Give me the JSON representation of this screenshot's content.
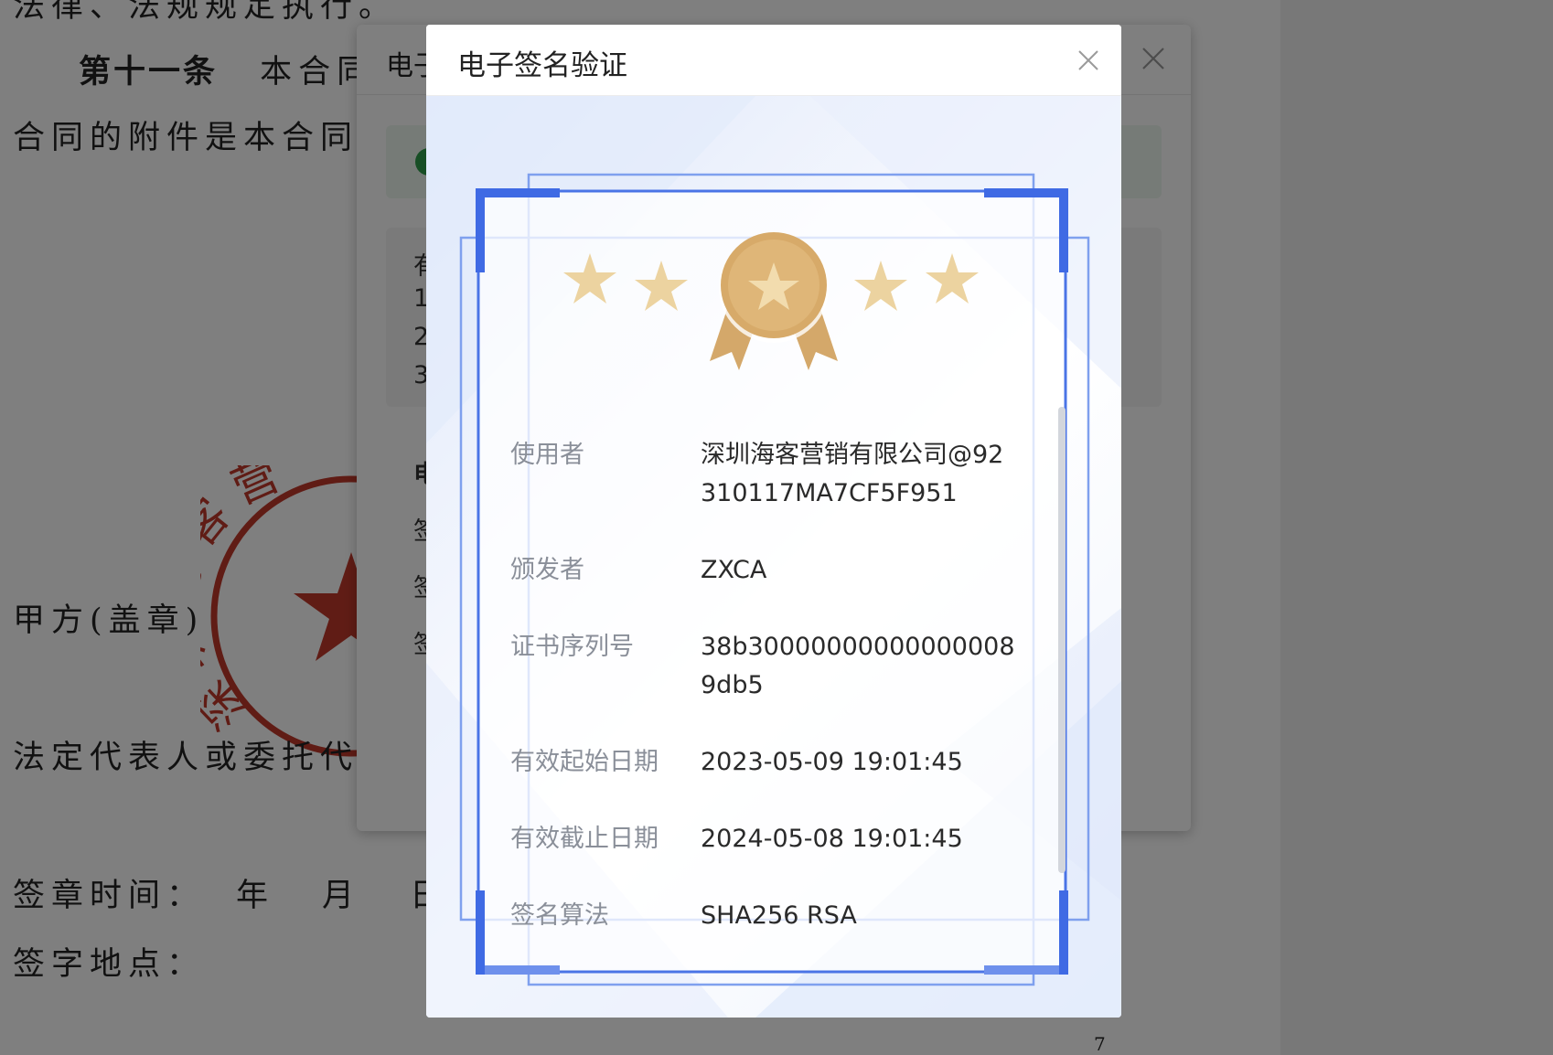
{
  "document": {
    "line1": "法律、法规规定执行。",
    "article_label": "第十一条",
    "article_text": "本合同",
    "line3": "合同的附件是本合同的",
    "party_a": "甲方(盖章)",
    "legal_rep": "法定代表人或委托代理",
    "sign_time": "签章时间：",
    "year": "年",
    "month": "月",
    "day": "日",
    "sign_place": "签字地点：",
    "page_number": "7",
    "seal_text": "深圳海客营"
  },
  "back_modal": {
    "title": "电子",
    "info_chars": [
      "有",
      "1",
      "2",
      "3"
    ],
    "bold_char": "电",
    "list_chars": [
      "签",
      "签",
      "签"
    ]
  },
  "modal": {
    "title": "电子签名验证",
    "fields": [
      {
        "label": "使用者",
        "value": "深圳海客营销有限公司@92310117MA7CF5F951"
      },
      {
        "label": "颁发者",
        "value": "ZXCA"
      },
      {
        "label": "证书序列号",
        "value": "38b300000000000000089db5"
      },
      {
        "label": "有效起始日期",
        "value": "2023-05-09 19:01:45"
      },
      {
        "label": "有效截止日期",
        "value": "2024-05-08 19:01:45"
      },
      {
        "label": "签名算法",
        "value": "SHA256 RSA"
      }
    ]
  },
  "colors": {
    "frame_blue": "#4a74e6",
    "medal_gold": "#d4a86a",
    "star_gold": "#ecd3a0",
    "seal_red": "#c0392b"
  }
}
